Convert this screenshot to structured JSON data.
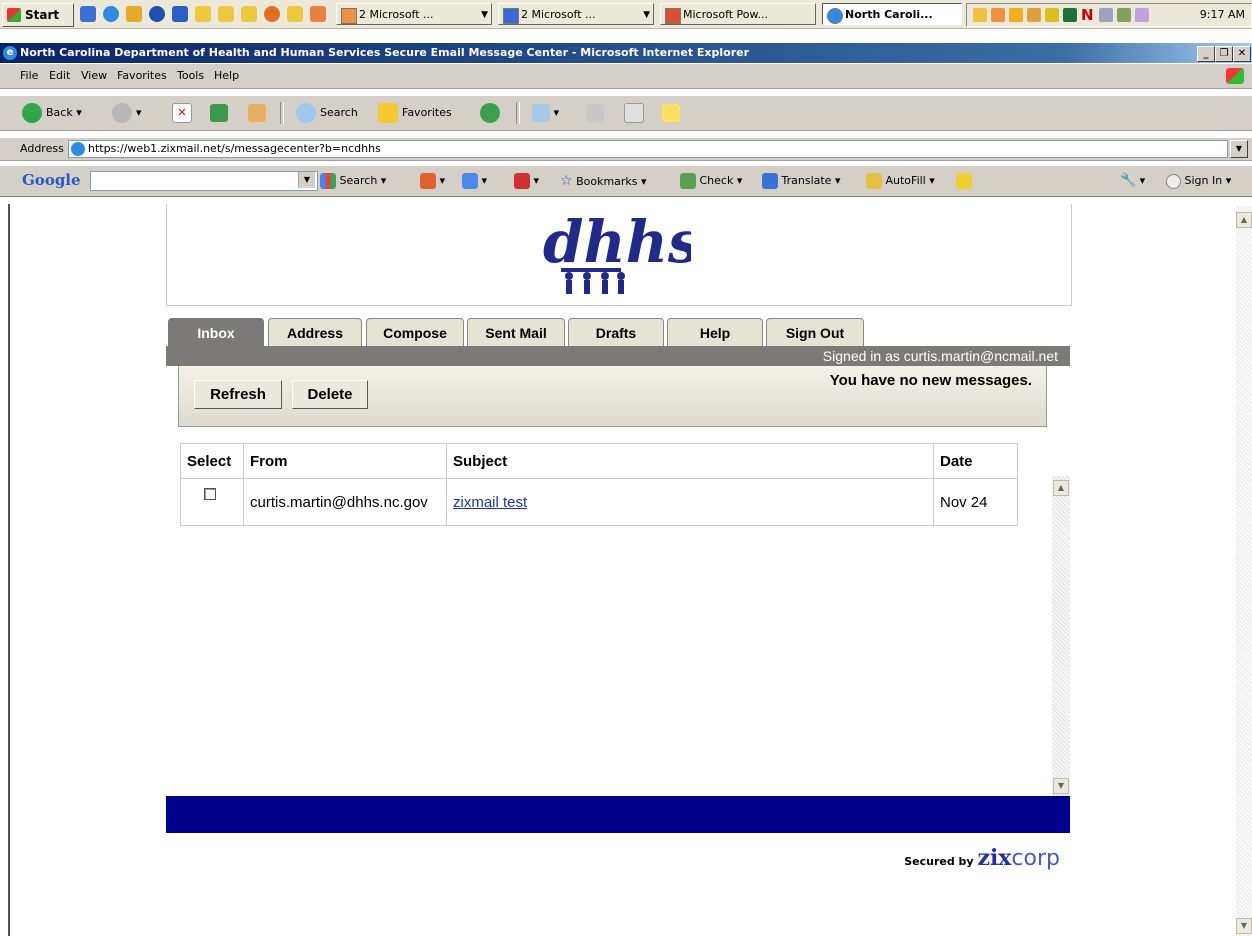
{
  "taskbar": {
    "start_label": "Start",
    "tasks": [
      {
        "label": "2 Microsoft ..."
      },
      {
        "label": "2 Microsoft ..."
      },
      {
        "label": "Microsoft Pow..."
      },
      {
        "label": "North Caroli..."
      }
    ],
    "clock": "9:17 AM"
  },
  "window": {
    "title": "North Carolina Department of Health and Human Services Secure Email Message Center - Microsoft Internet Explorer"
  },
  "menubar": {
    "items": [
      "File",
      "Edit",
      "View",
      "Favorites",
      "Tools",
      "Help"
    ]
  },
  "toolbar": {
    "back_label": "Back",
    "search_label": "Search",
    "favorites_label": "Favorites"
  },
  "address": {
    "label": "Address",
    "url": "https://web1.zixmail.net/s/messagecenter?b=ncdhhs"
  },
  "google_toolbar": {
    "logo": "Google",
    "search_label": "Search",
    "bookmarks_label": "Bookmarks",
    "check_label": "Check",
    "translate_label": "Translate",
    "autofill_label": "AutoFill",
    "signin_label": "Sign In"
  },
  "page": {
    "logo_text": "dhhs",
    "tabs": [
      "Inbox",
      "Address",
      "Compose",
      "Sent Mail",
      "Drafts",
      "Help",
      "Sign Out"
    ],
    "signed_in": "Signed in as curtis.martin@ncmail.net",
    "buttons": {
      "refresh": "Refresh",
      "delete": "Delete"
    },
    "status": "You have no new messages.",
    "table": {
      "headers": [
        "Select",
        "From",
        "Subject",
        "Date"
      ],
      "rows": [
        {
          "from": "curtis.martin@dhhs.nc.gov",
          "subject": "zixmail test",
          "date": "Nov 24"
        }
      ]
    },
    "secured_by": "Secured by",
    "brand_a": "zix",
    "brand_b": "corp"
  }
}
